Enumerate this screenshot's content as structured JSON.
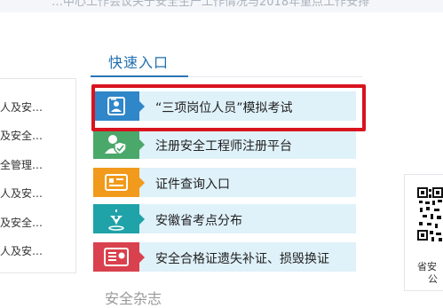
{
  "header": {
    "banner_text": "…中心工作会议关于安全生产工作情况与2018年重点工作安排"
  },
  "left_list": {
    "items": [
      "人及安…",
      "及安全…",
      "全管理…",
      "人及安…",
      "及安全…",
      "人及安…"
    ]
  },
  "quick_entry": {
    "title": "快速入口",
    "links": [
      {
        "label": "“三项岗位人员”模拟考试",
        "icon": "id-card-person-icon",
        "color": "#2f86c8",
        "highlighted": true
      },
      {
        "label": "注册安全工程师注册平台",
        "icon": "user-shield-icon",
        "color": "#4aa86a"
      },
      {
        "label": "证件查询入口",
        "icon": "id-card-icon",
        "color": "#f29a1b"
      },
      {
        "label": "安徽省考点分布",
        "icon": "location-pin-icon",
        "color": "#1fa2a8"
      },
      {
        "label": "安全合格证遗失补证、损毁换证",
        "icon": "certificate-icon",
        "color": "#d9414e"
      }
    ]
  },
  "next_section": {
    "title": "安全杂志"
  },
  "qr": {
    "line1": "省安",
    "line2": "公"
  },
  "colors": {
    "highlight_border": "#d8141e",
    "link_background": "#dff1f9",
    "title_blue": "#1f6fb0"
  }
}
